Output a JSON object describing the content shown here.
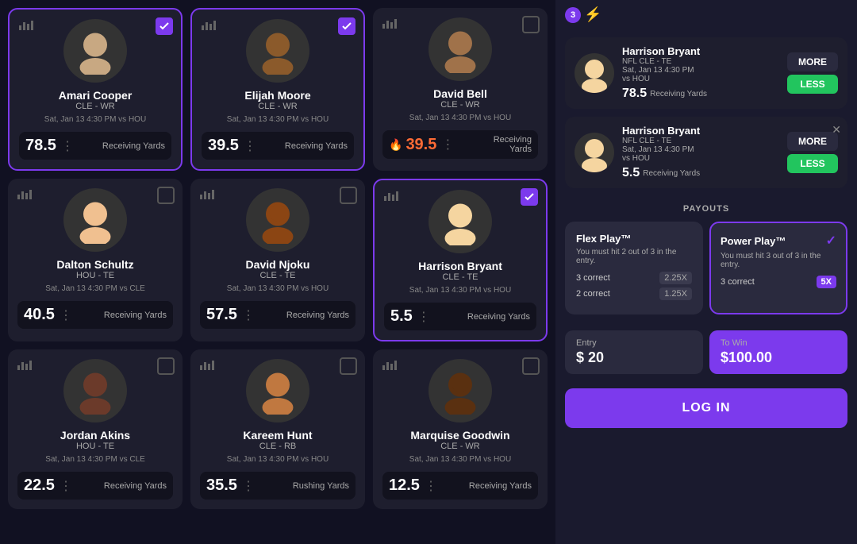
{
  "players": [
    {
      "id": 1,
      "name": "Amari Cooper",
      "team": "CLE - WR",
      "game_date": "Sat, Jan 13 4:30 PM",
      "game_vs": "vs HOU",
      "stat_value": "78.5",
      "stat_label": "Receiving Yards",
      "selected": true,
      "highlighted": false,
      "skin_color": "#c8a882"
    },
    {
      "id": 2,
      "name": "Elijah Moore",
      "team": "CLE - WR",
      "game_date": "Sat, Jan 13 4:30 PM",
      "game_vs": "vs HOU",
      "stat_value": "39.5",
      "stat_label": "Receiving Yards",
      "selected": true,
      "highlighted": false,
      "skin_color": "#8b5a2b"
    },
    {
      "id": 3,
      "name": "David Bell",
      "team": "CLE - WR",
      "game_date": "Sat, Jan 13 4:30 PM",
      "game_vs": "vs HOU",
      "stat_value": "39.5",
      "stat_label": "Receiving Yards",
      "selected": false,
      "highlighted": true,
      "skin_color": "#a0724a"
    },
    {
      "id": 4,
      "name": "Dalton Schultz",
      "team": "HOU - TE",
      "game_date": "Sat, Jan 13 4:30 PM",
      "game_vs": "vs CLE",
      "stat_value": "40.5",
      "stat_label": "Receiving Yards",
      "selected": false,
      "highlighted": false,
      "skin_color": "#f0c090"
    },
    {
      "id": 5,
      "name": "David Njoku",
      "team": "CLE - TE",
      "game_date": "Sat, Jan 13 4:30 PM",
      "game_vs": "vs HOU",
      "stat_value": "57.5",
      "stat_label": "Receiving Yards",
      "selected": false,
      "highlighted": false,
      "skin_color": "#8b4513"
    },
    {
      "id": 6,
      "name": "Harrison Bryant",
      "team": "CLE - TE",
      "game_date": "Sat, Jan 13 4:30 PM",
      "game_vs": "vs HOU",
      "stat_value": "5.5",
      "stat_label": "Receiving Yards",
      "selected": true,
      "highlighted": false,
      "skin_color": "#f5d5a0"
    },
    {
      "id": 7,
      "name": "Jordan Akins",
      "team": "HOU - TE",
      "game_date": "Sat, Jan 13 4:30 PM",
      "game_vs": "vs CLE",
      "stat_value": "22.5",
      "stat_label": "Receiving Yards",
      "selected": false,
      "highlighted": false,
      "skin_color": "#6b3a2a"
    },
    {
      "id": 8,
      "name": "Kareem Hunt",
      "team": "CLE - RB",
      "game_date": "Sat, Jan 13 4:30 PM",
      "game_vs": "vs HOU",
      "stat_value": "35.5",
      "stat_label": "Rushing Yards",
      "selected": false,
      "highlighted": false,
      "skin_color": "#c07840"
    },
    {
      "id": 9,
      "name": "Marquise Goodwin",
      "team": "CLE - WR",
      "game_date": "Sat, Jan 13 4:30 PM",
      "game_vs": "vs HOU",
      "stat_value": "12.5",
      "stat_label": "Receiving Yards",
      "selected": false,
      "highlighted": false,
      "skin_color": "#5a3010"
    }
  ],
  "slip": {
    "badge_count": "3",
    "card1": {
      "name": "Harrison Bryant",
      "league": "NFL",
      "team": "CLE - TE",
      "game_date": "Sat, Jan 13 4:30 PM",
      "game_vs": "vs HOU",
      "stat_value": "78.5",
      "stat_label": "Receiving Yards",
      "btn_more": "MORE",
      "btn_less": "LESS"
    },
    "card2": {
      "name": "Harrison Bryant",
      "league": "NFL",
      "team": "CLE - TE",
      "game_date": "Sat, Jan 13 4:30 PM",
      "game_vs": "vs HOU",
      "stat_value": "5.5",
      "stat_label": "Receiving Yards",
      "btn_more": "MORE",
      "btn_less": "LESS"
    }
  },
  "payouts": {
    "title": "PAYOUTS",
    "flex_play": {
      "label": "Flex Play™",
      "description": "You must hit 2 out of 3 in the entry.",
      "rows": [
        {
          "label": "3 correct",
          "multiplier": "2.25X"
        },
        {
          "label": "2 correct",
          "multiplier": "1.25X"
        }
      ]
    },
    "power_play": {
      "label": "Power Play™",
      "description": "You must hit 3 out of 3 in the entry.",
      "rows": [
        {
          "label": "3 correct",
          "multiplier": "5X"
        }
      ]
    }
  },
  "entry": {
    "label": "Entry",
    "value": "$ 20",
    "win_label": "To Win",
    "win_value": "$100.00"
  },
  "login_button": "LOG IN"
}
